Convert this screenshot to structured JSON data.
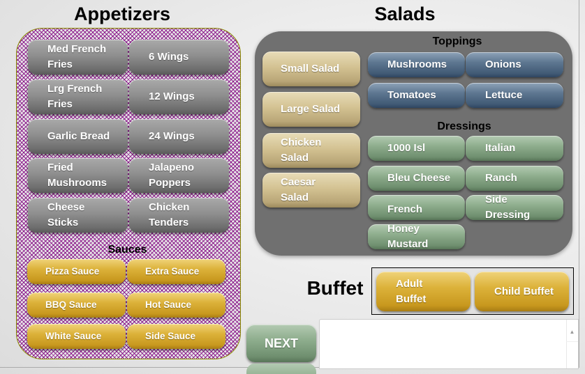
{
  "appetizers": {
    "title": "Appetizers",
    "items": [
      {
        "label": "Med French\nFries"
      },
      {
        "label": "6 Wings"
      },
      {
        "label": "Lrg French\nFries"
      },
      {
        "label": "12 Wings"
      },
      {
        "label": "Garlic Bread"
      },
      {
        "label": "24 Wings"
      },
      {
        "label": "Fried\nMushrooms"
      },
      {
        "label": "Jalapeno\nPoppers"
      },
      {
        "label": "Cheese\nSticks"
      },
      {
        "label": "Chicken\nTenders"
      }
    ],
    "sauces": {
      "title": "Sauces",
      "items": [
        {
          "label": "Pizza Sauce"
        },
        {
          "label": "Extra Sauce"
        },
        {
          "label": "BBQ Sauce"
        },
        {
          "label": "Hot Sauce"
        },
        {
          "label": "White Sauce"
        },
        {
          "label": "Side Sauce"
        }
      ]
    }
  },
  "salads": {
    "title": "Salads",
    "items": [
      {
        "label": "Small Salad"
      },
      {
        "label": "Large Salad"
      },
      {
        "label": "Chicken\nSalad"
      },
      {
        "label": "Caesar\nSalad"
      }
    ],
    "toppings": {
      "title": "Toppings",
      "items": [
        {
          "label": "Mushrooms"
        },
        {
          "label": "Onions"
        },
        {
          "label": "Tomatoes"
        },
        {
          "label": "Lettuce"
        }
      ]
    },
    "dressings": {
      "title": "Dressings",
      "items": [
        {
          "label": "1000 Isl"
        },
        {
          "label": "Italian"
        },
        {
          "label": "Bleu Cheese"
        },
        {
          "label": "Ranch"
        },
        {
          "label": "French"
        },
        {
          "label": "Side\nDressing"
        },
        {
          "label": "Honey\nMustard"
        }
      ]
    }
  },
  "buffet": {
    "title": "Buffet",
    "items": [
      {
        "label": "Adult\nBuffet"
      },
      {
        "label": "Child Buffet"
      }
    ]
  },
  "actions": {
    "next_label": "NEXT"
  },
  "order_box": {
    "scroll_up_glyph": "▲"
  }
}
